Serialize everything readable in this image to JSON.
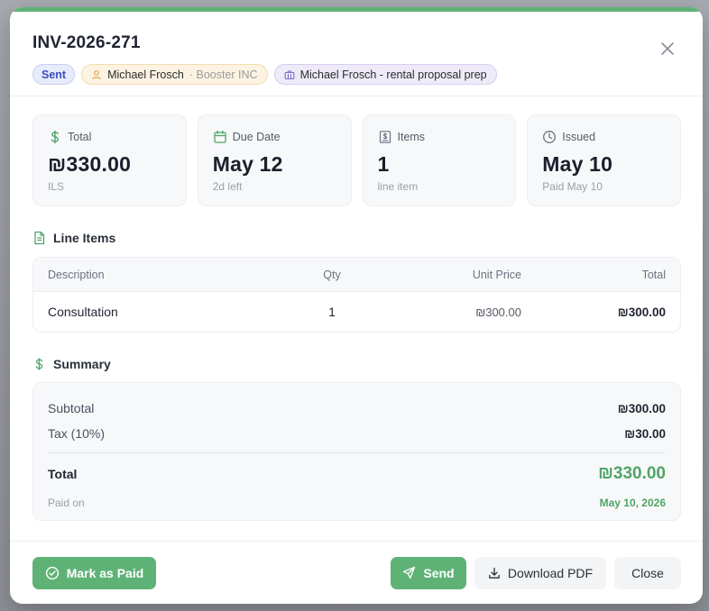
{
  "invoice": {
    "number": "INV-2026-271",
    "status": "Sent",
    "client_name": "Michael Frosch",
    "client_company": "· Booster INC",
    "project": "Michael Frosch - rental proposal prep"
  },
  "stats": [
    {
      "icon": "dollar-icon",
      "label": "Total",
      "value": "₪330.00",
      "sub": "ILS"
    },
    {
      "icon": "calendar-icon",
      "label": "Due Date",
      "value": "May 12",
      "sub": "2d left"
    },
    {
      "icon": "receipt-icon",
      "label": "Items",
      "value": "1",
      "sub": "line item"
    },
    {
      "icon": "clock-icon",
      "label": "Issued",
      "value": "May 10",
      "sub": "Paid May 10"
    }
  ],
  "line_items": {
    "title": "Line Items",
    "headers": {
      "description": "Description",
      "qty": "Qty",
      "unit_price": "Unit Price",
      "total": "Total"
    },
    "rows": [
      {
        "description": "Consultation",
        "qty": "1",
        "unit_price": "₪300.00",
        "total": "₪300.00"
      }
    ]
  },
  "summary": {
    "title": "Summary",
    "subtotal_label": "Subtotal",
    "subtotal": "₪300.00",
    "tax_label": "Tax (10%)",
    "tax": "₪30.00",
    "total_label": "Total",
    "total": "₪330.00",
    "paid_on_label": "Paid on",
    "paid_on": "May 10, 2026"
  },
  "footer": {
    "mark_paid": "Mark as Paid",
    "send": "Send",
    "download_pdf": "Download PDF",
    "close": "Close"
  },
  "colors": {
    "accent": "#5fb276",
    "accent_text": "#4fa566",
    "sent_badge": "#3b4cc0"
  }
}
